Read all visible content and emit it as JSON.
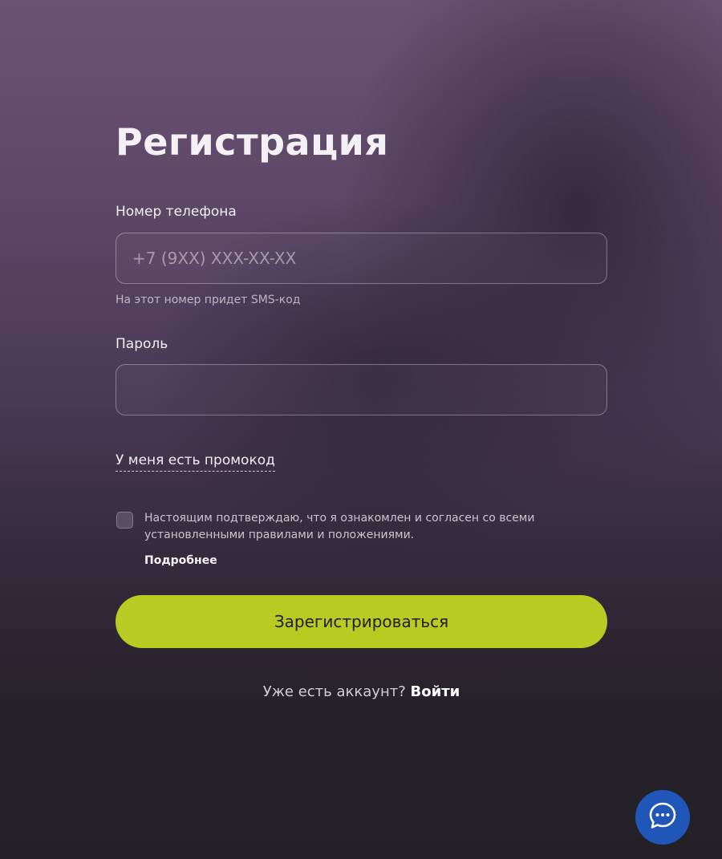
{
  "page": {
    "title": "Регистрация"
  },
  "phone": {
    "label": "Номер телефона",
    "placeholder": "+7 (9XX) XXX-XX-XX",
    "value": "",
    "hint": "На этот номер придет SMS-код"
  },
  "password": {
    "label": "Пароль",
    "value": ""
  },
  "promo": {
    "label": "У меня есть промокод"
  },
  "consent": {
    "checked": false,
    "text": "Настоящим подтверждаю, что я ознакомлен и согласен со всеми установленными правилами и положениями.",
    "more_label": "Подробнее"
  },
  "submit": {
    "label": "Зарегистрироваться"
  },
  "login": {
    "question": "Уже есть аккаунт?",
    "link_label": "Войти"
  },
  "chat": {
    "icon": "chat-bubble-icon"
  },
  "colors": {
    "accent": "#b7cb22",
    "chat": "#1f56b8"
  }
}
